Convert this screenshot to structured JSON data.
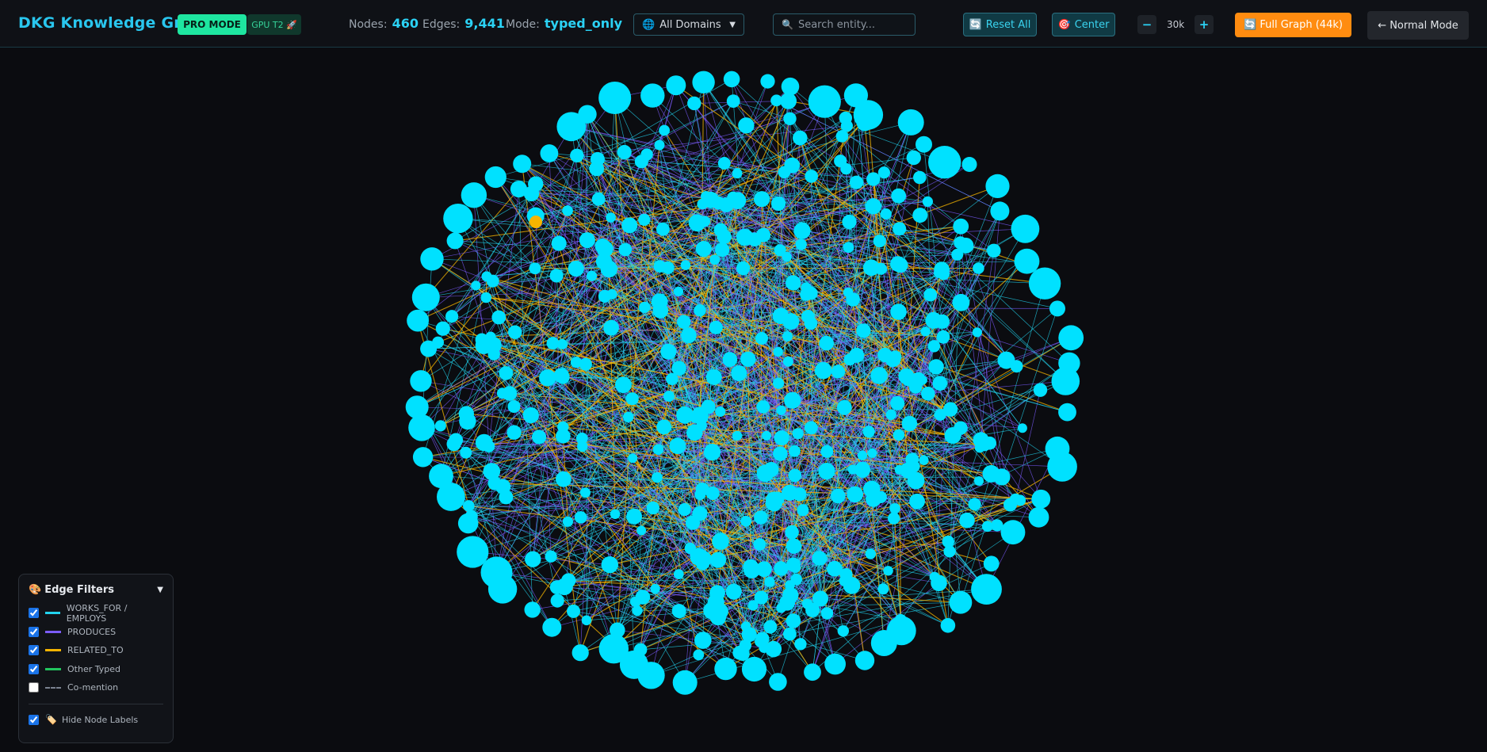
{
  "header": {
    "title": "DKG Knowledge Graph",
    "pro_badge": "PRO MODE",
    "gpu_badge": "GPU T2 🚀",
    "nodes_label": "Nodes:",
    "nodes_value": "460",
    "edges_label": "Edges:",
    "edges_value": "9,441",
    "mode_label": "Mode:",
    "mode_value": "typed_only",
    "domain_select": {
      "icon": "globe-icon",
      "value": "All Domains"
    },
    "search": {
      "placeholder": "Search entity...",
      "value": ""
    },
    "reset_button": "Reset All",
    "center_button": "Center",
    "zoom_out": "−",
    "zoom_value": "30k",
    "zoom_in": "+",
    "full_graph_button": "🔄 Full Graph (44k)",
    "normal_mode_button": "← Normal Mode"
  },
  "edge_filters": {
    "title": "Edge Filters",
    "items": [
      {
        "label": "WORKS_FOR / EMPLOYS",
        "color": "#22d3ee",
        "checked": true,
        "style": "solid"
      },
      {
        "label": "PRODUCES",
        "color": "#7c5cff",
        "checked": true,
        "style": "solid"
      },
      {
        "label": "RELATED_TO",
        "color": "#f5b400",
        "checked": true,
        "style": "solid"
      },
      {
        "label": "Other Typed",
        "color": "#22c55e",
        "checked": true,
        "style": "solid"
      },
      {
        "label": "Co-mention",
        "color": "#7a8290",
        "checked": false,
        "style": "dashed"
      }
    ],
    "hide_labels": {
      "label": "Hide Node Labels",
      "checked": true
    }
  },
  "graph": {
    "node_color": "#00e1ff",
    "highlight_node_color": "#f5b400",
    "background": "#0b0c10"
  }
}
